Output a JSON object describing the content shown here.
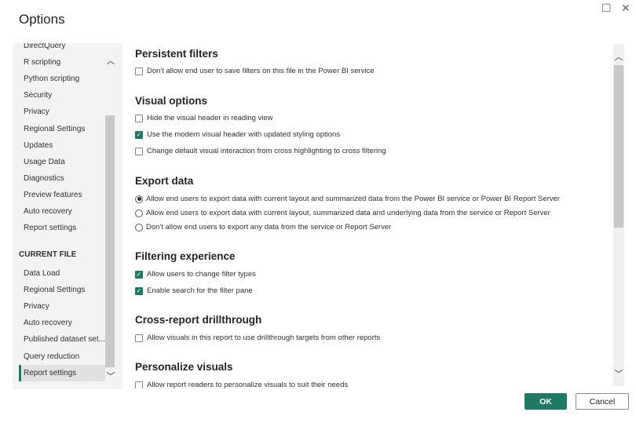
{
  "title": "Options",
  "window": {
    "maximize_icon": "square-icon",
    "close_icon": "close-icon"
  },
  "sidebar": {
    "global_items": [
      "DirectQuery",
      "R scripting",
      "Python scripting",
      "Security",
      "Privacy",
      "Regional Settings",
      "Updates",
      "Usage Data",
      "Diagnostics",
      "Preview features",
      "Auto recovery",
      "Report settings"
    ],
    "current_file_header": "CURRENT FILE",
    "current_file_items": [
      "Data Load",
      "Regional Settings",
      "Privacy",
      "Auto recovery",
      "Published dataset set...",
      "Query reduction",
      "Report settings"
    ],
    "selected": "Report settings"
  },
  "sections": {
    "persistent": {
      "title": "Persistent filters",
      "opts": [
        {
          "label": "Don't allow end user to save filters on this file in the Power BI service",
          "checked": false
        }
      ]
    },
    "visual": {
      "title": "Visual options",
      "opts": [
        {
          "label": "Hide the visual header in reading view",
          "checked": false
        },
        {
          "label": "Use the modern visual header with updated styling options",
          "checked": true
        },
        {
          "label": "Change default visual interaction from cross highlighting to cross filtering",
          "checked": false
        }
      ]
    },
    "export": {
      "title": "Export data",
      "opts": [
        {
          "label": "Allow end users to export data with current layout and summarized data from the Power BI service or Power BI Report Server",
          "selected": true
        },
        {
          "label": "Allow end users to export data with current layout, summarized data and underlying data from the service or Report Server",
          "selected": false
        },
        {
          "label": "Don't allow end users to export any data from the service or Report Server",
          "selected": false
        }
      ]
    },
    "filtering": {
      "title": "Filtering experience",
      "opts": [
        {
          "label": "Allow users to change filter types",
          "checked": true
        },
        {
          "label": "Enable search for the filter pane",
          "checked": true
        }
      ]
    },
    "drill": {
      "title": "Cross-report drillthrough",
      "opts": [
        {
          "label": "Allow visuals in this report to use drillthrough targets from other reports",
          "checked": false
        }
      ]
    },
    "personalize": {
      "title": "Personalize visuals",
      "opts": [
        {
          "label": "Allow report readers to personalize visuals to suit their needs",
          "checked": false
        }
      ]
    }
  },
  "buttons": {
    "ok": "OK",
    "cancel": "Cancel"
  },
  "colors": {
    "accent": "#1f7a63"
  }
}
